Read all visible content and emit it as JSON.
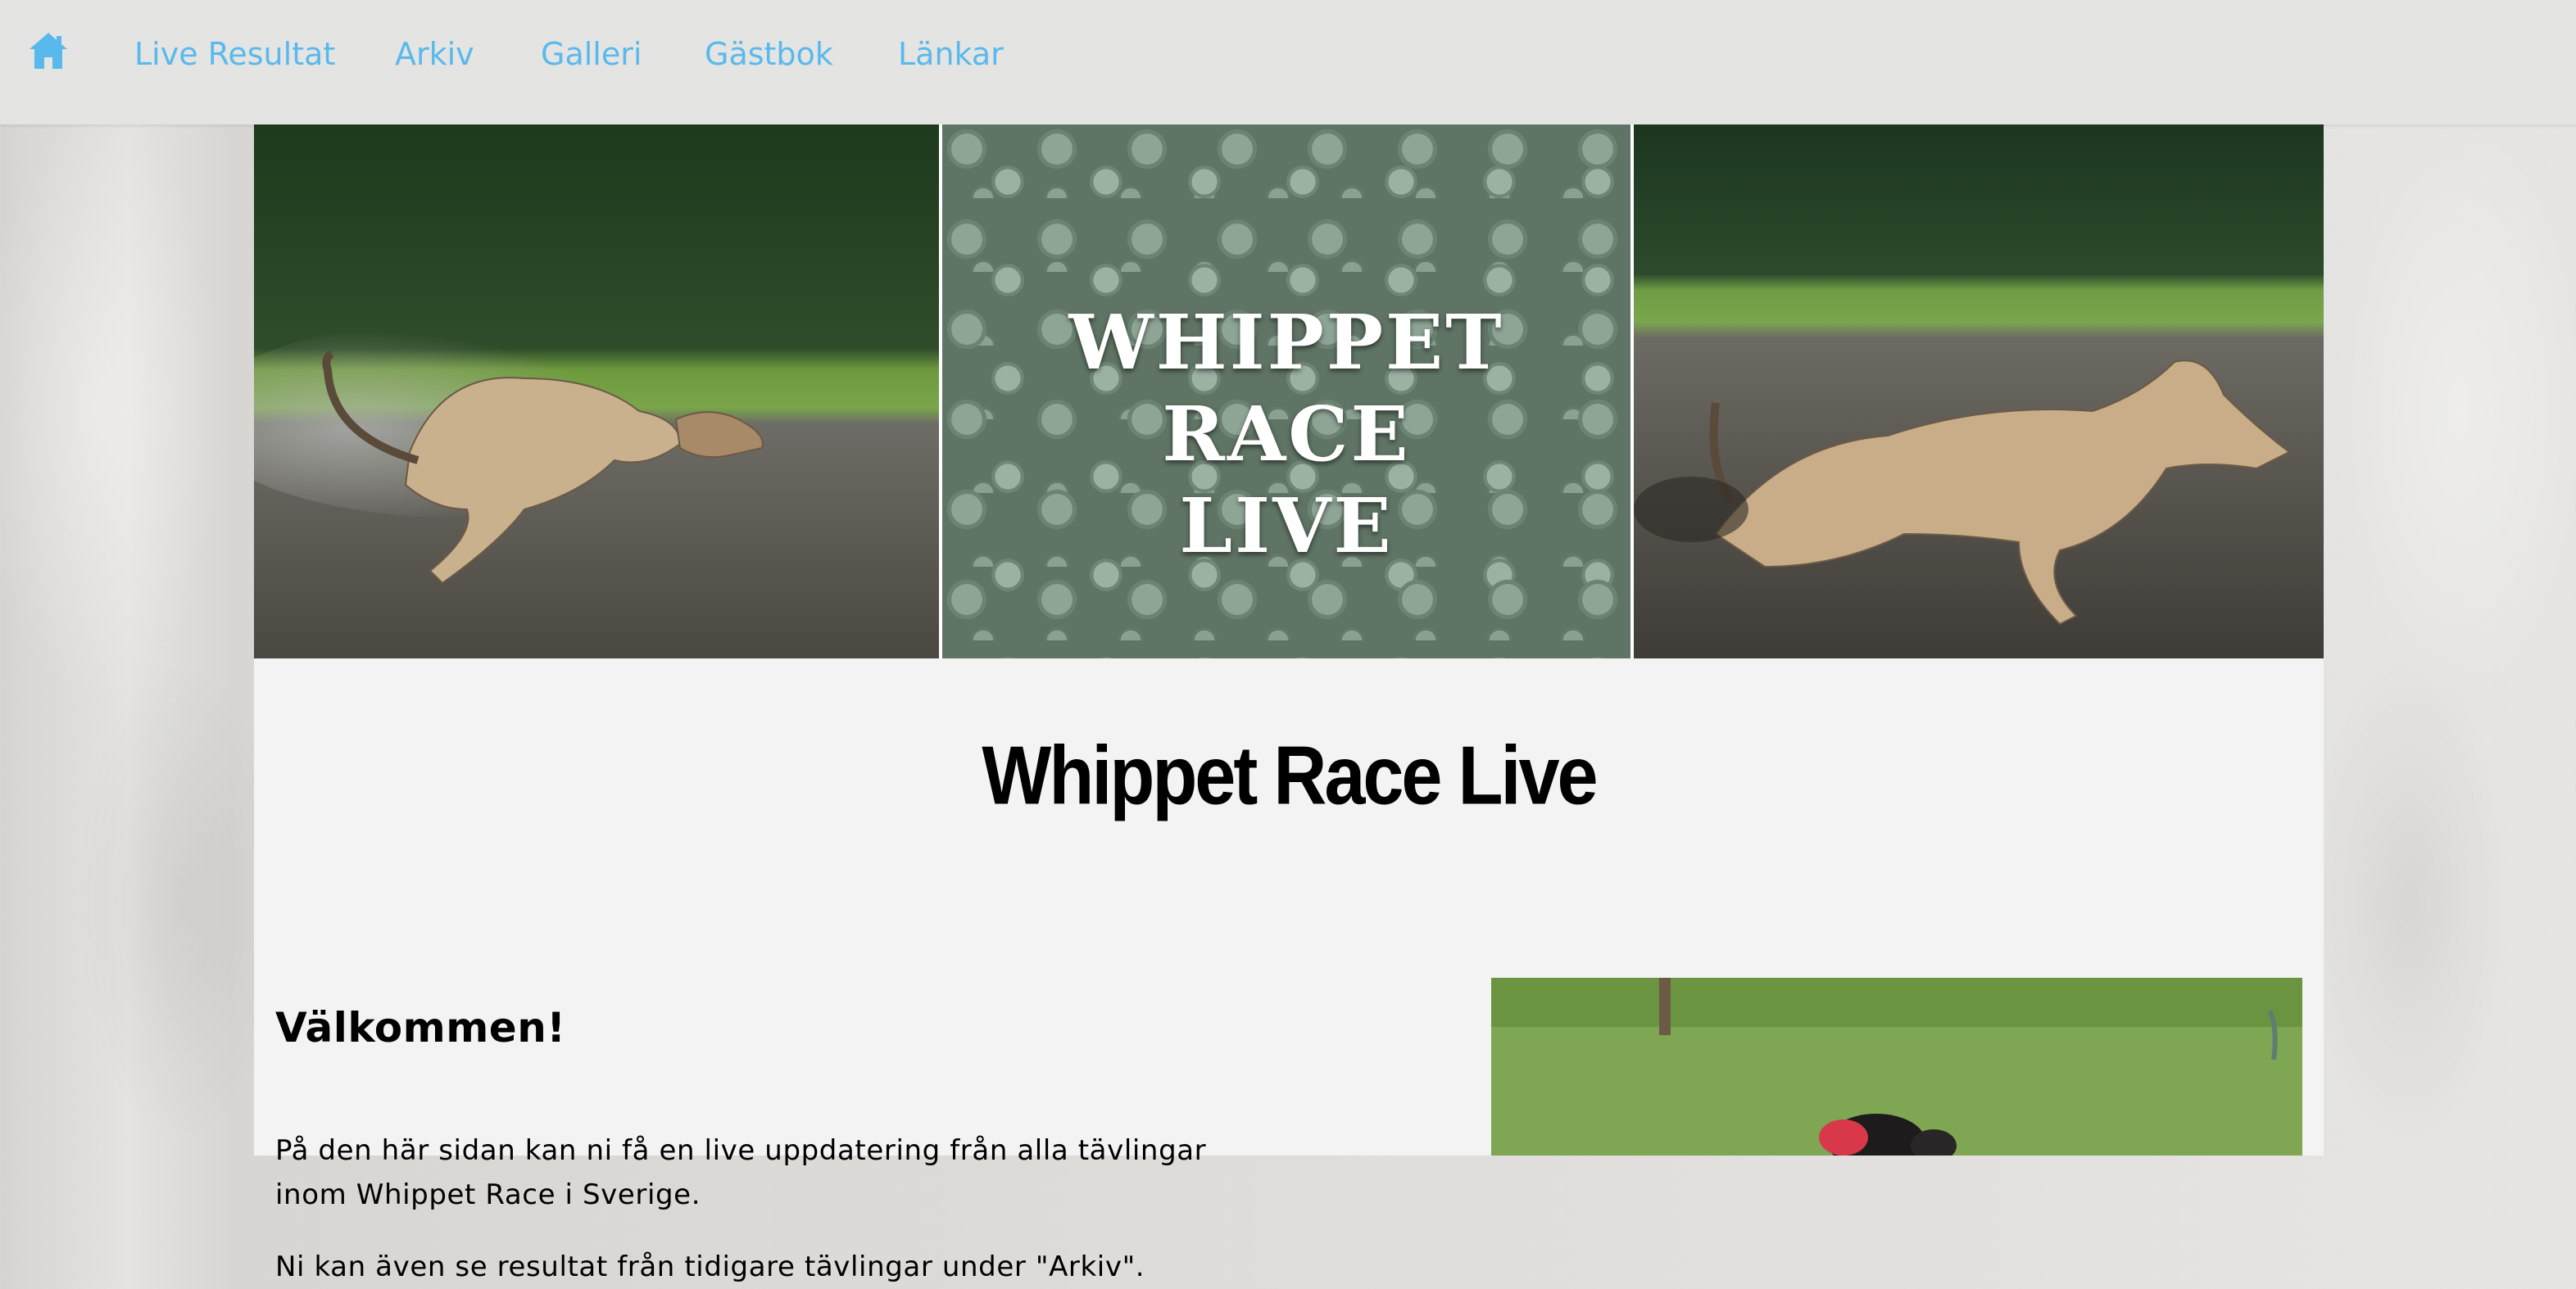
{
  "nav": {
    "home_icon": "home-icon",
    "links": [
      "Live Resultat",
      "Arkiv",
      "Galleri",
      "Gästbok",
      "Länkar"
    ]
  },
  "banner": {
    "logo_lines": [
      "WHIPPET",
      "RACE",
      "LIVE"
    ]
  },
  "page": {
    "title": "Whippet Race Live",
    "welcome_heading": "Välkommen!",
    "paragraph1": "På den här sidan kan ni få en live uppdatering från alla tävlingar inom Whippet Race i Sverige.",
    "paragraph2": "Ni kan även se resultat från tidigare tävlingar under \"Arkiv\"."
  },
  "colors": {
    "nav_bg": "#e4e4e2",
    "nav_link": "#5ab9ec",
    "content_bg": "#f3f3f3"
  }
}
